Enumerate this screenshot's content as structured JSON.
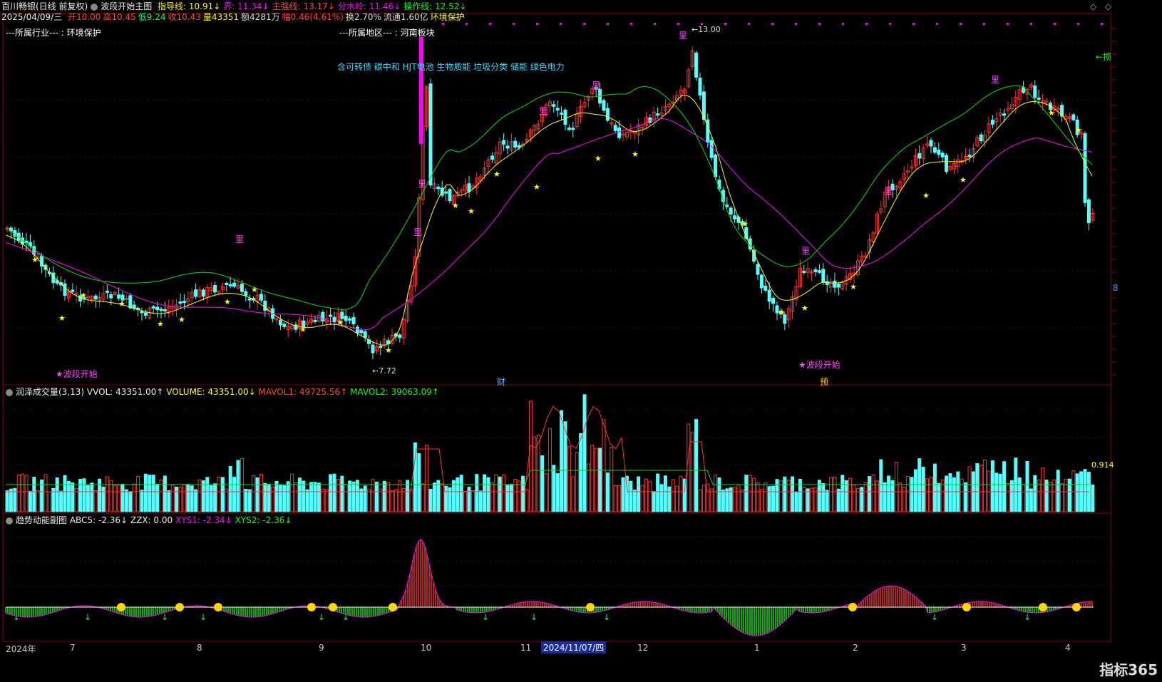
{
  "header": {
    "stock": "百川畅银(日线 前复权)",
    "main_indicator": "波段开始主图",
    "lines": [
      {
        "label": "指导线: 10.91↓",
        "color": "#ffff00"
      },
      {
        "label": "界: 11.34↓",
        "color": "#ff00ff"
      },
      {
        "label": "主强线: 13.17↓",
        "color": "#ff4444"
      },
      {
        "label": "分水岭: 11.46↓",
        "color": "#ff00ff"
      },
      {
        "label": "操作线: 12.52↓",
        "color": "#00ff00"
      }
    ],
    "date": "2025/04/09/三",
    "quote": [
      {
        "label": "开10.00",
        "color": "#ff4444"
      },
      {
        "label": "高10.45",
        "color": "#ff4444"
      },
      {
        "label": "低9.24",
        "color": "#00ff66"
      },
      {
        "label": "收10.43",
        "color": "#ff4444"
      },
      {
        "label": "量43351",
        "color": "#ffff00"
      },
      {
        "label": "额4281万",
        "color": "#dddddd"
      },
      {
        "label": "幅0.46(4.61%)",
        "color": "#ff4444"
      },
      {
        "label": "换2.70%",
        "color": "#dddddd"
      },
      {
        "label": "流通1.60亿",
        "color": "#dddddd"
      },
      {
        "label": "环境保护",
        "color": "#ffff00"
      }
    ]
  },
  "info": {
    "industry": "---所属行业--- : 环境保护",
    "region": "---所属地区--- : 河南板块",
    "concepts": "含可转债 碳中和 HJT电池 生物质能 垃圾分类 储能 绿色电力"
  },
  "annotations": {
    "high_price": "13.00",
    "low_price": "7.72",
    "wave_start_1": "★波段开始",
    "wave_start_2": "★波段开始",
    "cai_tag": "财",
    "yu_tag": "预",
    "li_mark": "里",
    "right_cut": "←损"
  },
  "volume_panel": {
    "title": "润泽成交量(3,13)",
    "vvol": "VVOL: 43351.00↑",
    "volume": "VOLUME: 43351.00↓",
    "mavol1": "MAVOL1: 49725.56↑",
    "mavol2": "MAVOL2: 39063.09↑",
    "right_value": "0.914"
  },
  "trend_panel": {
    "title": "趋势动能副图",
    "abc5": "ABC5: -2.36↓",
    "zzx": "ZZX: 0.00",
    "xys1": "XYS1: -2.34↓",
    "xys2": "XYS2: -2.36↓"
  },
  "x_axis": {
    "labels": [
      "2024年",
      "7",
      "8",
      "9",
      "10",
      "11",
      "12",
      "1",
      "2",
      "3",
      "4"
    ],
    "cursor_date": "2024/11/07/四"
  },
  "right_axis_value": "8",
  "logo": "指标365",
  "colors": {
    "up": "#ff3333",
    "down": "#54ffff",
    "guide": "#ffff00",
    "ma_magenta": "#ff00ff",
    "ma_green": "#00dd00"
  }
}
